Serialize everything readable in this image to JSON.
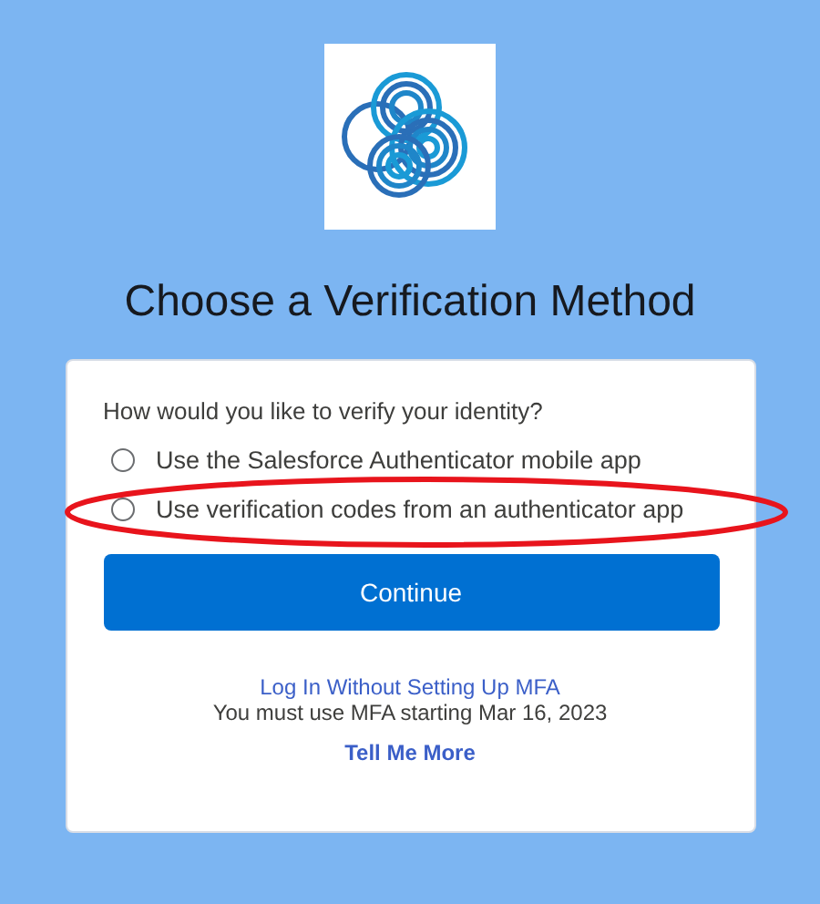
{
  "title": "Choose a Verification Method",
  "form": {
    "question": "How would you like to verify your identity?",
    "options": [
      {
        "label": "Use the Salesforce Authenticator mobile app",
        "selected": false
      },
      {
        "label": "Use verification codes from an authenticator app",
        "selected": false
      }
    ],
    "button": "Continue"
  },
  "footer": {
    "skip_link": "Log In Without Setting Up MFA",
    "notice": "You must use MFA starting Mar 16, 2023",
    "more_link": "Tell Me More"
  }
}
